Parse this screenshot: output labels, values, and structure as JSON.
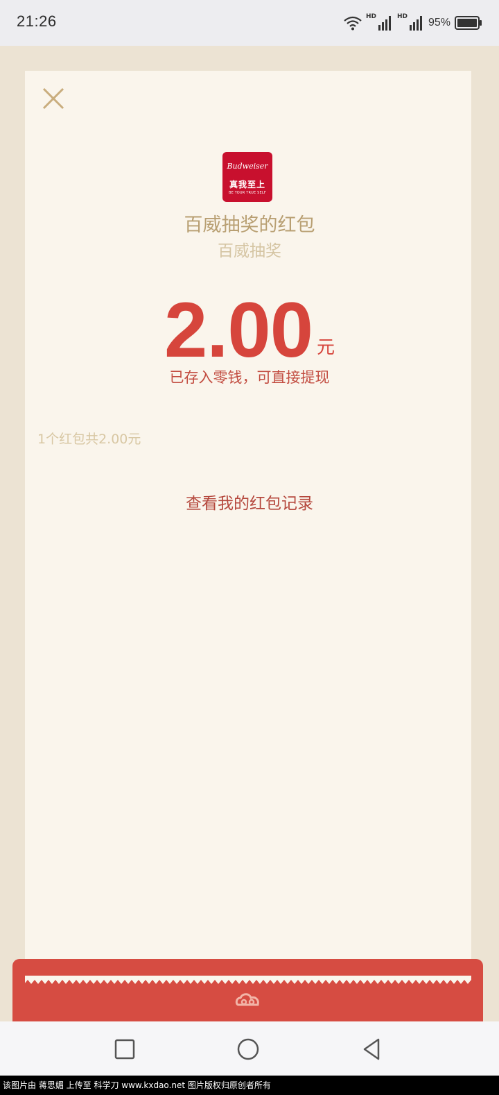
{
  "status_bar": {
    "time": "21:26",
    "network_label_1": "HD",
    "network_label_2": "HD",
    "battery": "95%"
  },
  "logo": {
    "script": "Budweiser",
    "cn": "真我至上",
    "en": "BE YOUR TRUE SELF"
  },
  "envelope": {
    "sender": "百威抽奖的红包",
    "wish": "百威抽奖",
    "amount": "2.00",
    "unit": "元",
    "saved_note": "已存入零钱，可直接提现",
    "summary": "1个红包共2.00元",
    "record_link": "查看我的红包记录"
  },
  "colors": {
    "accent_red": "#d6453c",
    "gold": "#b89f72",
    "card_bg": "#faf5ec",
    "page_bg": "#ece3d3"
  },
  "icons": {
    "close": "close-icon",
    "footer": "cloud-ornament-icon",
    "nav_recent": "square-icon",
    "nav_home": "circle-icon",
    "nav_back": "triangle-back-icon"
  },
  "watermark": "该图片由 蒋思媚 上传至 科学刀 www.kxdao.net 图片版权归原创者所有"
}
